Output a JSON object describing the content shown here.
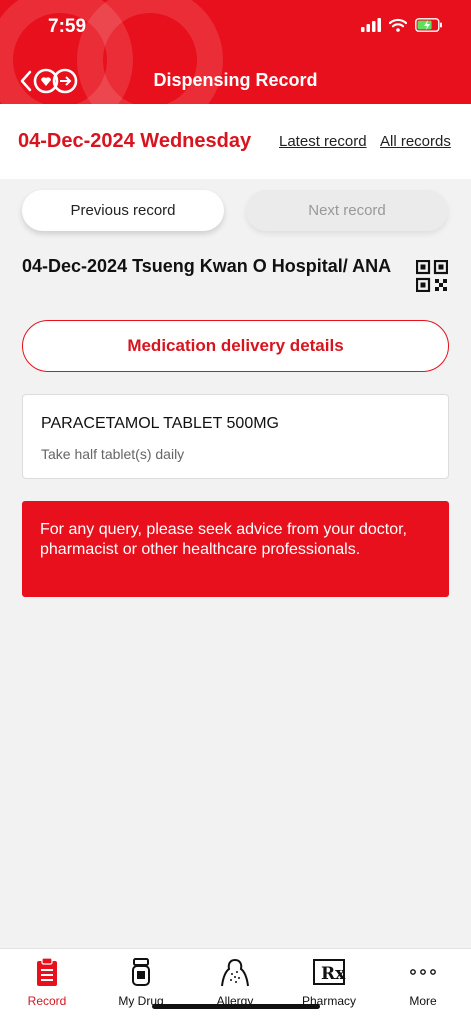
{
  "status_bar": {
    "time": "7:59"
  },
  "header": {
    "title": "Dispensing Record"
  },
  "date_bar": {
    "date": "04-Dec-2024 Wednesday",
    "latest_link": "Latest record",
    "all_link": "All records"
  },
  "nav_buttons": {
    "previous": "Previous record",
    "next": "Next record"
  },
  "record": {
    "title": "04-Dec-2024 Tsueng Kwan O Hospital/ ANA",
    "delivery_button": "Medication delivery details",
    "drugs": [
      {
        "name": "PARACETAMOL TABLET 500MG",
        "instruction": "Take half tablet(s) daily"
      }
    ]
  },
  "notice": "For any query, please seek advice from your doctor, pharmacist or other healthcare professionals.",
  "tabs": [
    {
      "label": "Record",
      "icon": "clipboard-icon",
      "active": true
    },
    {
      "label": "My Drug",
      "icon": "pill-bottle-icon",
      "active": false
    },
    {
      "label": "Allergy",
      "icon": "allergy-body-icon",
      "active": false
    },
    {
      "label": "Pharmacy",
      "icon": "rx-icon",
      "active": false
    },
    {
      "label": "More",
      "icon": "more-dots-icon",
      "active": false
    }
  ],
  "colors": {
    "brand_red": "#e8101c",
    "text_red": "#d8141f",
    "background": "#f2f2f2"
  }
}
